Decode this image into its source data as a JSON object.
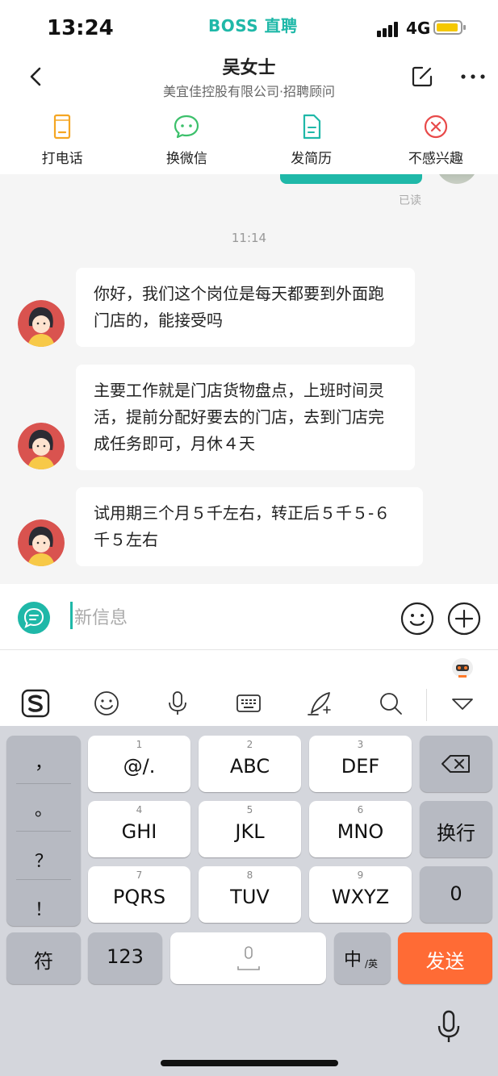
{
  "status_bar": {
    "time": "13:24",
    "brand": "BOSS 直聘",
    "network": "4G",
    "battery_level": 0.85,
    "battery_color": "#f5c800"
  },
  "header": {
    "title": "吴女士",
    "subtitle": "美宜佳控股有限公司·招聘顾问",
    "back_icon": "chevron-left-icon",
    "edit_icon": "edit-icon",
    "more_icon": "more-icon"
  },
  "actions": [
    {
      "label": "打电话",
      "icon": "phone-icon",
      "color": "#f5a623"
    },
    {
      "label": "换微信",
      "icon": "wechat-icon",
      "color": "#3cc06b"
    },
    {
      "label": "发简历",
      "icon": "resume-icon",
      "color": "#1fb8a8"
    },
    {
      "label": "不感兴趣",
      "icon": "close-circle-icon",
      "color": "#e84a4a"
    }
  ],
  "chat": {
    "read_status": "已读",
    "timestamp": "11:14",
    "messages": [
      {
        "text": "你好，我们这个岗位是每天都要到外面跑门店的，能接受吗"
      },
      {
        "text": "主要工作就是门店货物盘点，上班时间灵活，提前分配好要去的门店，去到门店完成任务即可，月休４天"
      },
      {
        "text": "试用期三个月５千左右，转正后５千５-６千５左右"
      }
    ]
  },
  "input": {
    "placeholder": "新信息"
  },
  "keyboard": {
    "punctuation": [
      "，",
      "。",
      "？",
      "！"
    ],
    "rows": [
      [
        {
          "num": "1",
          "label": "@/."
        },
        {
          "num": "2",
          "label": "ABC"
        },
        {
          "num": "3",
          "label": "DEF"
        }
      ],
      [
        {
          "num": "4",
          "label": "GHI"
        },
        {
          "num": "5",
          "label": "JKL"
        },
        {
          "num": "6",
          "label": "MNO"
        }
      ],
      [
        {
          "num": "7",
          "label": "PQRS"
        },
        {
          "num": "8",
          "label": "TUV"
        },
        {
          "num": "9",
          "label": "WXYZ"
        }
      ]
    ],
    "enter_label": "换行",
    "zero_label": "0",
    "symbol_label": "符",
    "numeric_label": "123",
    "lang_main": "中",
    "lang_sub": "/英",
    "send_label": "发送",
    "send_color": "#ff6b35"
  }
}
